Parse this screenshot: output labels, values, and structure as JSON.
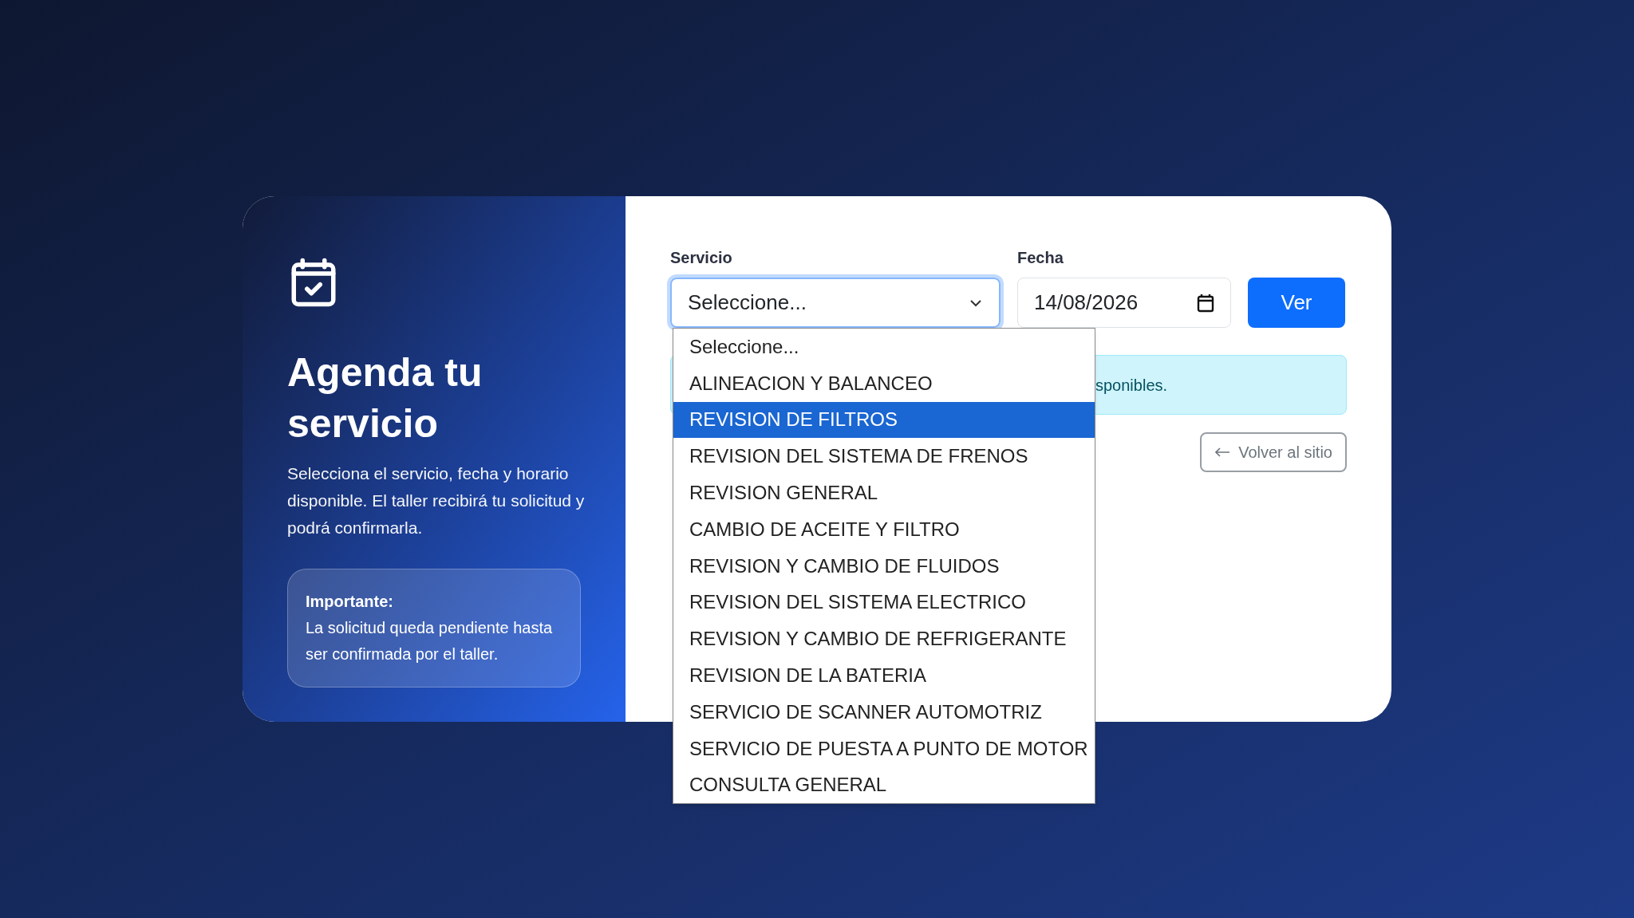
{
  "intro": {
    "title": "Agenda tu servicio",
    "text": "Selecciona el servicio, fecha y horario disponible. El taller recibirá tu solicitud y podrá confirmarla.",
    "note_title": "Importante:",
    "note_text": "La solicitud queda pendiente hasta ser confirmada por el taller."
  },
  "form": {
    "service": {
      "label": "Servicio",
      "value": "Seleccione...",
      "expanded": true,
      "options": [
        {
          "label": "Seleccione...",
          "highlighted": false
        },
        {
          "label": "ALINEACION Y BALANCEO",
          "highlighted": false
        },
        {
          "label": "REVISION DE FILTROS",
          "highlighted": true
        },
        {
          "label": "REVISION DEL SISTEMA DE FRENOS",
          "highlighted": false
        },
        {
          "label": "REVISION GENERAL",
          "highlighted": false
        },
        {
          "label": "CAMBIO DE ACEITE Y FILTRO",
          "highlighted": false
        },
        {
          "label": "REVISION Y CAMBIO DE FLUIDOS",
          "highlighted": false
        },
        {
          "label": "REVISION DEL SISTEMA ELECTRICO",
          "highlighted": false
        },
        {
          "label": "REVISION Y CAMBIO DE REFRIGERANTE",
          "highlighted": false
        },
        {
          "label": "REVISION DE LA BATERIA",
          "highlighted": false
        },
        {
          "label": "SERVICIO DE SCANNER AUTOMOTRIZ",
          "highlighted": false
        },
        {
          "label": "SERVICIO DE PUESTA A PUNTO DE MOTOR",
          "highlighted": false
        },
        {
          "label": "CONSULTA GENERAL",
          "highlighted": false
        }
      ]
    },
    "date": {
      "label": "Fecha",
      "value": "14/08/2026"
    },
    "submit": "Ver"
  },
  "alert": "sponibles.",
  "back_button": "Volver al sitio"
}
